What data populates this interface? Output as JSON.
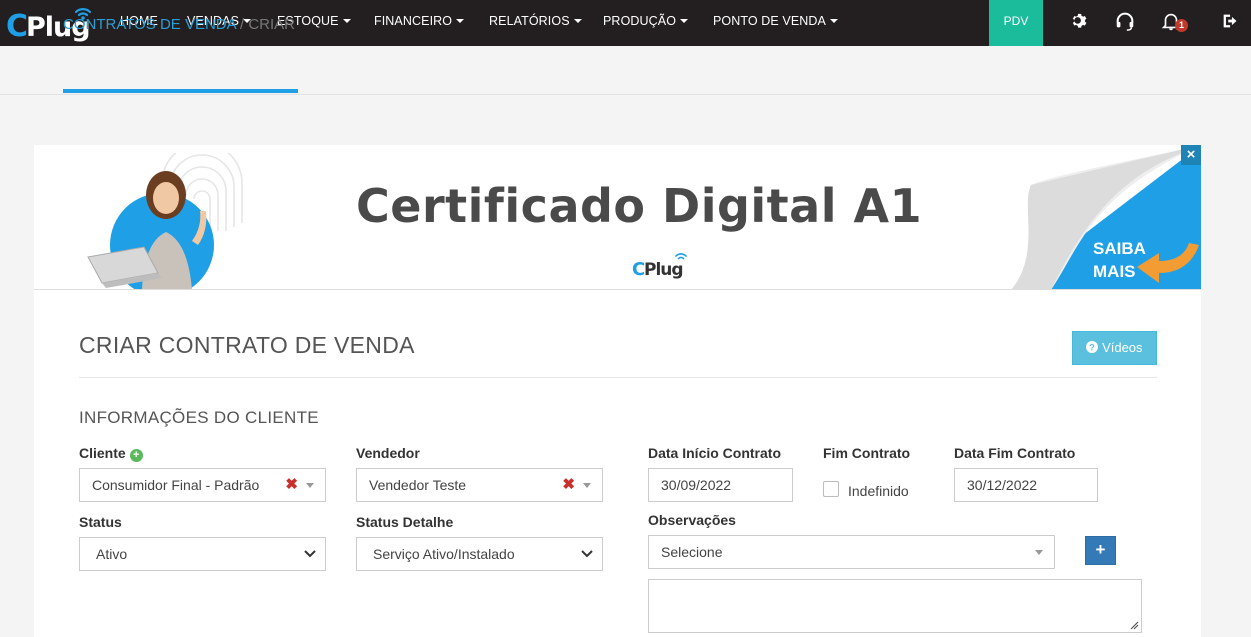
{
  "nav": {
    "logo_text": "CPlug",
    "items": [
      {
        "label": "HOME",
        "dropdown": false
      },
      {
        "label": "VENDAS",
        "dropdown": true
      },
      {
        "label": "ESTOQUE",
        "dropdown": true
      },
      {
        "label": "FINANCEIRO",
        "dropdown": true
      },
      {
        "label": "RELATÓRIOS",
        "dropdown": true
      },
      {
        "label": "PRODUÇÃO",
        "dropdown": true
      },
      {
        "label": "PONTO DE VENDA",
        "dropdown": true
      }
    ],
    "pdv_label": "PDV",
    "notification_count": "1",
    "pdv_color": "#1abc9c",
    "icons": [
      "gear-icon",
      "headset-icon",
      "bell-icon",
      "logout-icon"
    ]
  },
  "breadcrumb": {
    "link": "CONTRATOS DE VENDA",
    "separator": " / ",
    "current": "CRIAR"
  },
  "banner": {
    "title": "Certificado Digital A1",
    "logo_text": "CPlug",
    "cta": "SAIBA MAIS",
    "close": "×"
  },
  "form": {
    "page_title": "CRIAR CONTRATO DE VENDA",
    "videos_button": "Vídeos",
    "section_title": "INFORMAÇÕES DO CLIENTE",
    "cliente": {
      "label": "Cliente",
      "value": "Consumidor Final - Padrão"
    },
    "vendedor": {
      "label": "Vendedor",
      "value": "Vendedor Teste"
    },
    "data_inicio": {
      "label": "Data Início Contrato",
      "value": "30/09/2022"
    },
    "fim_contrato": {
      "label": "Fim Contrato",
      "checkbox_label": "Indefinido",
      "checked": false
    },
    "data_fim": {
      "label": "Data Fim Contrato",
      "value": "30/12/2022"
    },
    "status": {
      "label": "Status",
      "value": "Ativo"
    },
    "status_detalhe": {
      "label": "Status Detalhe",
      "value": "Serviço Ativo/Instalado"
    },
    "observacoes": {
      "label": "Observações",
      "placeholder": "Selecione",
      "add_button": "+",
      "text": ""
    }
  }
}
